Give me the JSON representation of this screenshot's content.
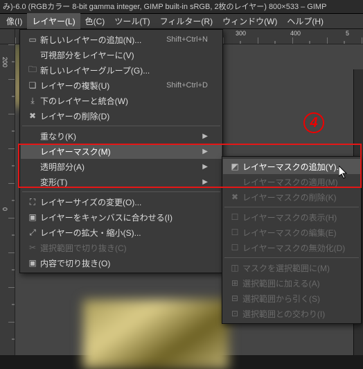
{
  "title": "み)-6.0 (RGBカラー 8-bit gamma integer, GIMP built-in sRGB, 2枚のレイヤー) 800×533 – GIMP",
  "menubar": {
    "items": [
      "像(I)",
      "レイヤー(L)",
      "色(C)",
      "ツール(T)",
      "フィルター(R)",
      "ウィンドウ(W)",
      "ヘルプ(H)"
    ],
    "active": 1
  },
  "ruler_top": {
    "t300": "300",
    "t400": "400",
    "t5": "5"
  },
  "ruler_left": {
    "t0": "0",
    "t200": "200"
  },
  "annotation": {
    "circle": "4"
  },
  "layer_menu": {
    "new_layer": "新しいレイヤーの追加(N)...",
    "new_layer_accel": "Shift+Ctrl+N",
    "new_from_visible": "可視部分をレイヤーに(V)",
    "new_group": "新しいレイヤーグループ(G)...",
    "duplicate": "レイヤーの複製(U)",
    "duplicate_accel": "Shift+Ctrl+D",
    "merge_down": "下のレイヤーと統合(W)",
    "delete": "レイヤーの削除(D)",
    "boundary": "重なり(K)",
    "mask": "レイヤーマスク(M)",
    "transparency": "透明部分(A)",
    "transform": "変形(T)",
    "layer_size": "レイヤーサイズの変更(O)...",
    "fit_canvas": "レイヤーをキャンバスに合わせる(I)",
    "scale": "レイヤーの拡大・縮小(S)...",
    "crop_sel": "選択範囲で切り抜き(C)",
    "crop_content": "内容で切り抜き(O)"
  },
  "mask_menu": {
    "add": "レイヤーマスクの追加(Y)...",
    "apply": "レイヤーマスクの適用(M)",
    "delete": "レイヤーマスクの削除(K)",
    "show": "レイヤーマスクの表示(H)",
    "edit": "レイヤーマスクの編集(E)",
    "disable": "レイヤーマスクの無効化(D)",
    "mask_to_sel": "マスクを選択範囲に(M)",
    "add_to_sel": "選択範囲に加える(A)",
    "sub_from_sel": "選択範囲から引く(S)",
    "intersect_sel": "選択範囲との交わり(I)"
  }
}
